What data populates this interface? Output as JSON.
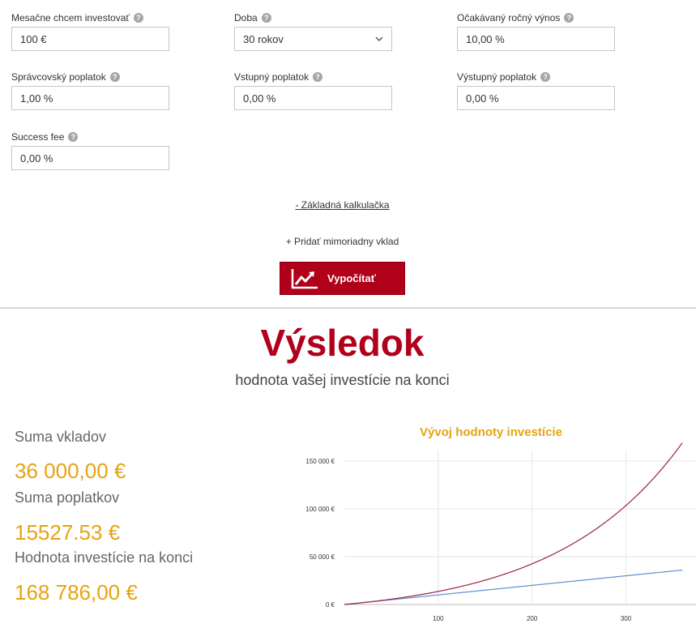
{
  "form": {
    "fields": [
      {
        "label": "Mesačne chcem investovať",
        "value": "100 €"
      },
      {
        "label": "Doba",
        "value": "30 rokov"
      },
      {
        "label": "Očakávaný ročný výnos",
        "value": "10,00 %"
      },
      {
        "label": "Správcovský poplatok",
        "value": "1,00 %"
      },
      {
        "label": "Vstupný poplatok",
        "value": "0,00 %"
      },
      {
        "label": "Výstupný poplatok",
        "value": "0,00 %"
      },
      {
        "label": "Success fee",
        "value": "0,00 %"
      }
    ],
    "help_icon": "question-circle-icon",
    "help_glyph": "?",
    "basic_link": "- Základná kalkulačka",
    "extra_deposit_link": "+ Pridať mimoriadny vklad",
    "calculate_button": "Vypočítať",
    "calculate_icon": "chart-trend-icon"
  },
  "result": {
    "title": "Výsledok",
    "subtitle": "hodnota vašej investície na konci",
    "stats": [
      {
        "label": "Suma vkladov",
        "value": "36 000,00 €"
      },
      {
        "label": "Suma poplatkov",
        "value": "15527.53 €"
      },
      {
        "label": "Hodnota investície na konci",
        "value": "168 786,00 €"
      }
    ]
  },
  "colors": {
    "brand_red": "#b0001a",
    "accent_gold": "#e6a410",
    "value_line": "#9b1f4a",
    "deposit_line": "#5b8fd0"
  },
  "chart_data": {
    "type": "line",
    "title": "Vývoj hodnoty investície",
    "x": {
      "min": 0,
      "max": 360,
      "ticks": [
        100,
        200,
        300
      ]
    },
    "y": {
      "min": 0,
      "max": 160000,
      "ticks": [
        0,
        50000,
        100000,
        150000
      ],
      "tick_labels": [
        "0 €",
        "50 000 €",
        "100 000 €",
        "150 000 €"
      ]
    },
    "grid": true,
    "series": [
      {
        "key": "value",
        "monthly_deposit": 100,
        "annual_return": 0.1,
        "annual_fee": 0.01,
        "final_value": 168786
      },
      {
        "key": "deposits",
        "monthly_deposit": 100,
        "final_value": 36000
      }
    ]
  }
}
